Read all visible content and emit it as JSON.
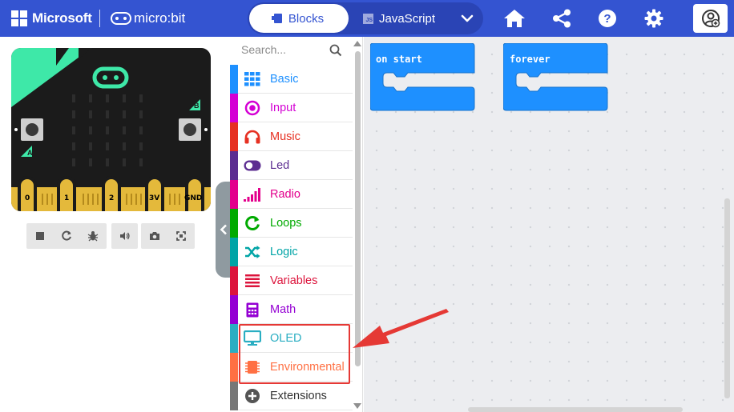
{
  "header": {
    "brand": "Microsoft",
    "product": "micro:bit",
    "tabs": [
      {
        "label": "Blocks",
        "active": true
      },
      {
        "label": "JavaScript",
        "active": false
      }
    ],
    "js_badge": "JS",
    "icons": [
      "home-icon",
      "share-icon",
      "help-icon",
      "settings-icon",
      "user-icon"
    ],
    "color": "#3454d1"
  },
  "simulator": {
    "buttons": [
      "A",
      "B"
    ],
    "pins": [
      "0",
      "1",
      "2",
      "3V",
      "GND"
    ],
    "controls": [
      "stop-icon",
      "restart-icon",
      "debug-icon",
      "mute-icon",
      "screenshot-icon",
      "fullscreen-icon"
    ]
  },
  "toolbox": {
    "search_placeholder": "Search...",
    "categories": [
      {
        "label": "Basic",
        "color": "#1e90ff",
        "icon": "grid-icon"
      },
      {
        "label": "Input",
        "color": "#d400d4",
        "icon": "radio-button-icon"
      },
      {
        "label": "Music",
        "color": "#e63022",
        "icon": "headphones-icon"
      },
      {
        "label": "Led",
        "color": "#5c2d91",
        "icon": "toggle-icon"
      },
      {
        "label": "Radio",
        "color": "#e3008c",
        "icon": "signal-bars-icon"
      },
      {
        "label": "Loops",
        "color": "#00aa00",
        "icon": "refresh-icon"
      },
      {
        "label": "Logic",
        "color": "#00a4a6",
        "icon": "shuffle-icon"
      },
      {
        "label": "Variables",
        "color": "#dc143c",
        "icon": "lines-icon"
      },
      {
        "label": "Math",
        "color": "#9400d3",
        "icon": "calculator-icon"
      },
      {
        "label": "OLED",
        "color": "#2aaec2",
        "icon": "monitor-icon"
      },
      {
        "label": "Environmental",
        "color": "#ff7043",
        "icon": "chip-icon"
      },
      {
        "label": "Extensions",
        "color": "#777777",
        "icon": "plus-circle-icon"
      }
    ]
  },
  "workspace": {
    "blocks": [
      {
        "label": "on start",
        "color": "#1e90ff"
      },
      {
        "label": "forever",
        "color": "#1e90ff"
      }
    ]
  },
  "annotation": {
    "color": "#e53935"
  }
}
